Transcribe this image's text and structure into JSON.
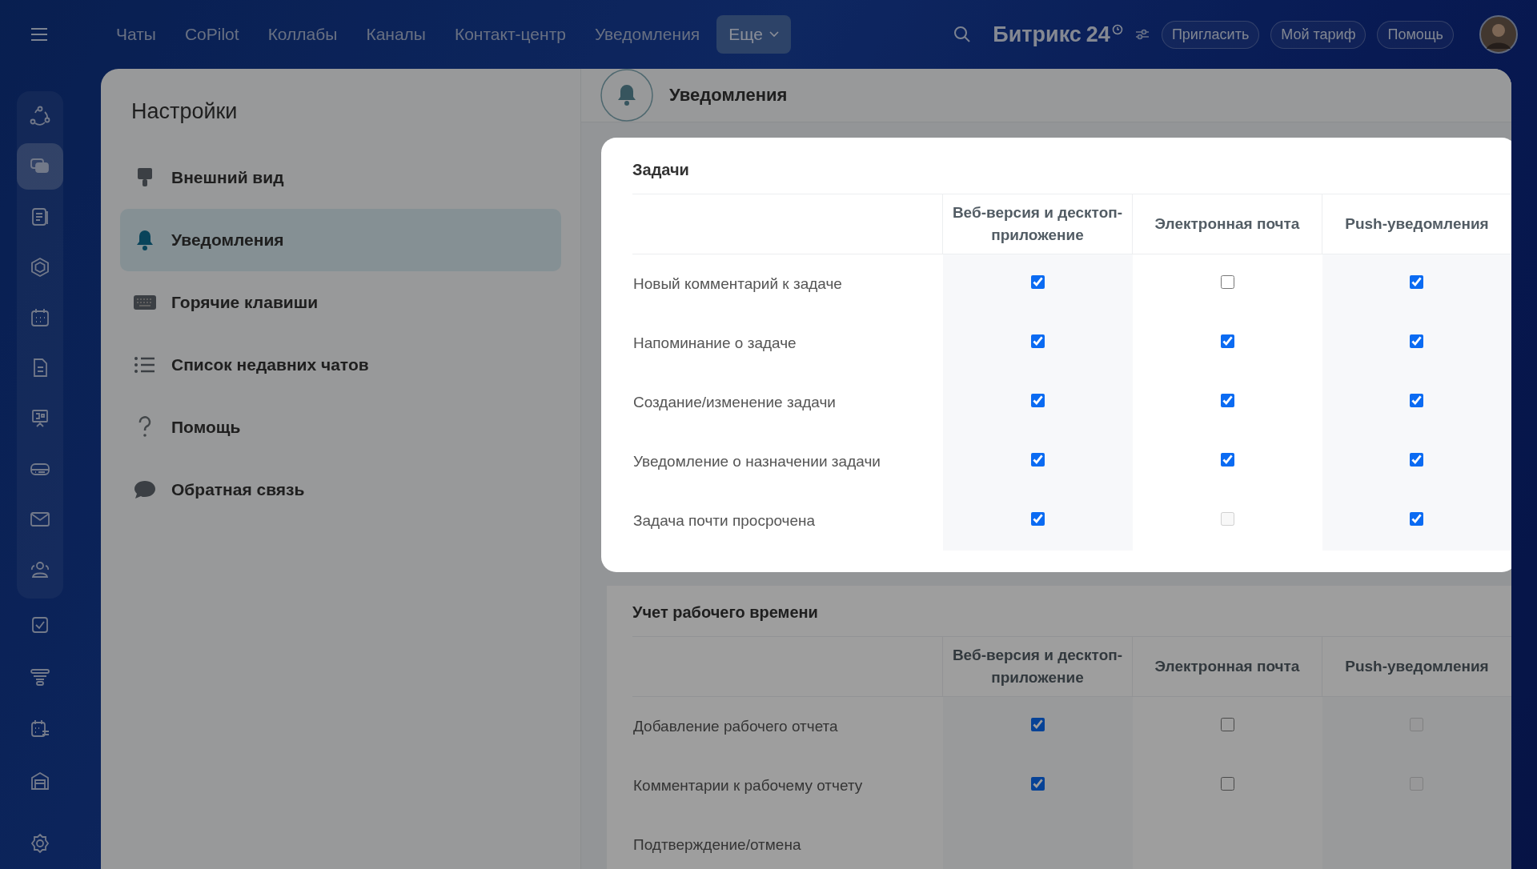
{
  "top_nav": {
    "items": [
      {
        "label": "Чаты",
        "selected": false
      },
      {
        "label": "CoPilot",
        "selected": false
      },
      {
        "label": "Коллабы",
        "selected": false
      },
      {
        "label": "Каналы",
        "selected": false
      },
      {
        "label": "Контакт-центр",
        "selected": false
      },
      {
        "label": "Уведомления",
        "selected": false
      },
      {
        "label": "Еще",
        "selected": true
      }
    ],
    "logo": {
      "name": "Битрикс",
      "number": "24"
    },
    "buttons": [
      "Пригласить",
      "Мой тариф",
      "Помощь"
    ]
  },
  "rail": [
    {
      "selected": false
    },
    {
      "selected": true
    },
    {
      "selected": false
    },
    {
      "selected": false
    },
    {
      "selected": false
    },
    {
      "selected": false
    },
    {
      "selected": false
    },
    {
      "selected": false
    },
    {
      "selected": false
    },
    {
      "selected": false
    },
    {
      "selected": false
    },
    {
      "selected": false
    },
    {
      "selected": false
    },
    {
      "selected": false
    },
    {
      "selected": false
    }
  ],
  "settings": {
    "title": "Настройки",
    "items": [
      {
        "label": "Внешний вид",
        "selected": false
      },
      {
        "label": "Уведомления",
        "selected": true
      },
      {
        "label": "Горячие клавиши",
        "selected": false
      },
      {
        "label": "Список недавних чатов",
        "selected": false
      },
      {
        "label": "Помощь",
        "selected": false
      },
      {
        "label": "Обратная связь",
        "selected": false
      }
    ]
  },
  "content": {
    "title": "Уведомления",
    "sections": [
      {
        "title": "Задачи",
        "highlighted": true,
        "columns": [
          "Веб-версия и десктоп-приложение",
          "Электронная почта",
          "Push-уведомления"
        ],
        "rows": [
          {
            "label": "Новый комментарий к задаче",
            "checks": [
              {
                "checked": true,
                "disabled": false
              },
              {
                "checked": false,
                "disabled": false
              },
              {
                "checked": true,
                "disabled": false
              }
            ]
          },
          {
            "label": "Напоминание о задаче",
            "checks": [
              {
                "checked": true,
                "disabled": false
              },
              {
                "checked": true,
                "disabled": false
              },
              {
                "checked": true,
                "disabled": false
              }
            ]
          },
          {
            "label": "Создание/изменение задачи",
            "checks": [
              {
                "checked": true,
                "disabled": false
              },
              {
                "checked": true,
                "disabled": false
              },
              {
                "checked": true,
                "disabled": false
              }
            ]
          },
          {
            "label": "Уведомление о назначении задачи",
            "checks": [
              {
                "checked": true,
                "disabled": false
              },
              {
                "checked": true,
                "disabled": false
              },
              {
                "checked": true,
                "disabled": false
              }
            ]
          },
          {
            "label": "Задача почти просрочена",
            "checks": [
              {
                "checked": true,
                "disabled": false
              },
              {
                "checked": false,
                "disabled": true
              },
              {
                "checked": true,
                "disabled": false
              }
            ]
          }
        ]
      },
      {
        "title": "Учет рабочего времени",
        "highlighted": false,
        "columns": [
          "Веб-версия и десктоп-приложение",
          "Электронная почта",
          "Push-уведомления"
        ],
        "rows": [
          {
            "label": "Добавление рабочего отчета",
            "checks": [
              {
                "checked": true,
                "disabled": false
              },
              {
                "checked": false,
                "disabled": false
              },
              {
                "checked": false,
                "disabled": true
              }
            ]
          },
          {
            "label": "Комментарии к рабочему отчету",
            "checks": [
              {
                "checked": true,
                "disabled": false
              },
              {
                "checked": false,
                "disabled": false
              },
              {
                "checked": false,
                "disabled": true
              }
            ]
          },
          {
            "label": "Подтверждение/отмена"
          }
        ]
      }
    ]
  }
}
